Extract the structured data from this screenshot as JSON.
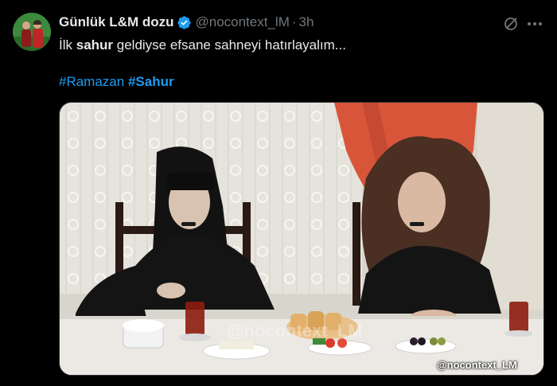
{
  "tweet": {
    "display_name": "Günlük L&M dozu",
    "handle": "@nocontext_lM",
    "separator": "·",
    "time": "3h",
    "body_prefix": "İlk ",
    "body_bold": "sahur",
    "body_suffix": " geldiyse efsane sahneyi hatırlayalım...",
    "hashtags": [
      "#Ramazan",
      "#Sahur"
    ]
  },
  "icons": {
    "verified": "verified-badge-icon",
    "grok": "grok-icon",
    "more": "more-options-icon"
  },
  "media": {
    "watermark": "@nocontext_LM",
    "watermark_center": "@nocontext_LM"
  },
  "colors": {
    "background": "#000000",
    "text": "#e7e9ea",
    "muted": "#71767b",
    "link": "#1d9bf0",
    "verified": "#1d9bf0"
  }
}
